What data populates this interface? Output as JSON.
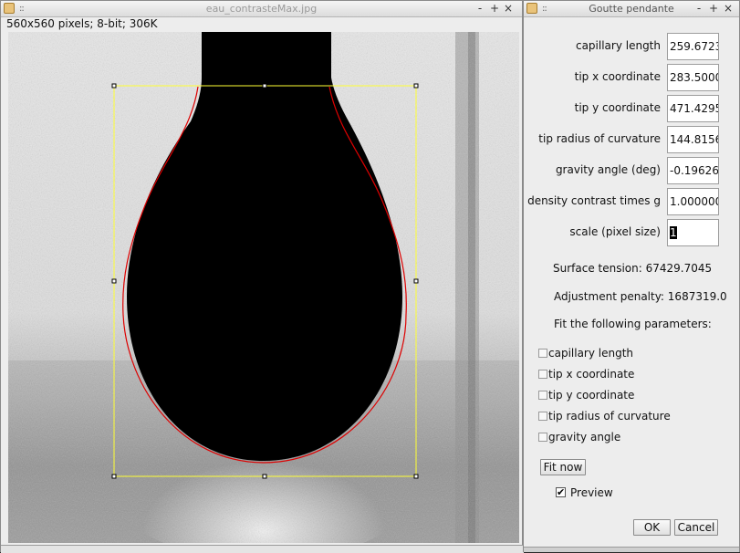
{
  "image_window": {
    "title": "eau_contrasteMax.jpg",
    "info": "560x560 pixels; 8-bit; 306K",
    "controls": {
      "minimize": "-",
      "maximize": "+",
      "close": "×"
    },
    "icons": [
      "app-icon",
      "grip-icon"
    ]
  },
  "dialog": {
    "title": "Goutte pendante",
    "controls": {
      "minimize": "-",
      "maximize": "+",
      "close": "×"
    },
    "fields": [
      {
        "label": "capillary length",
        "value": "259.6723"
      },
      {
        "label": "tip x coordinate",
        "value": "283.5000"
      },
      {
        "label": "tip y coordinate",
        "value": "471.4295"
      },
      {
        "label": "tip radius of curvature",
        "value": "144.8156"
      },
      {
        "label": "gravity angle (deg)",
        "value": "-0.19626"
      },
      {
        "label": "density contrast times g",
        "value": "1.000000"
      },
      {
        "label": "scale (pixel size)",
        "value": "1"
      }
    ],
    "surface_tension": "Surface tension: 67429.7045",
    "adjustment_penalty": "Adjustment penalty: 1687319.0",
    "fit_heading": "Fit the following parameters:",
    "checkboxes": [
      {
        "label": "capillary length",
        "checked": false
      },
      {
        "label": "tip x coordinate",
        "checked": false
      },
      {
        "label": "tip y coordinate",
        "checked": false
      },
      {
        "label": "tip radius of curvature",
        "checked": false
      },
      {
        "label": "gravity angle",
        "checked": false
      }
    ],
    "fit_now": "Fit now",
    "preview_label": "Preview",
    "preview_checked": true,
    "preview_mark": "✔",
    "ok": "OK",
    "cancel": "Cancel"
  },
  "colors": {
    "selection_rect": "#ffff33",
    "fit_curve": "#dd0000",
    "drop": "#000000"
  }
}
